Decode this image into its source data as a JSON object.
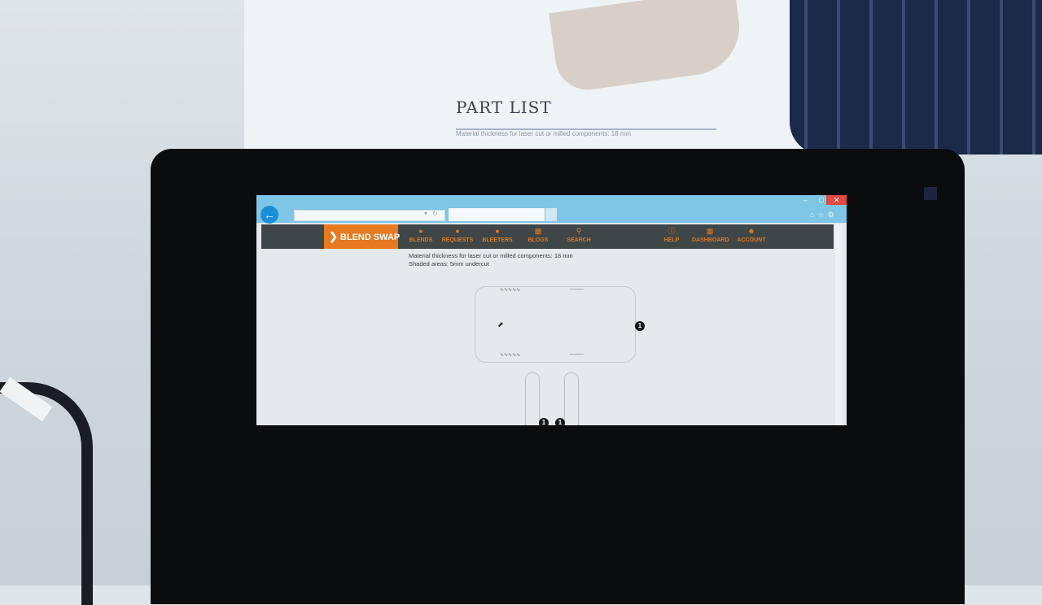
{
  "background": {
    "paper_title": "PART LIST",
    "paper_text": "Material thickness for laser cut or milled components: 18 mm"
  },
  "browser": {
    "back_icon": "back-arrow-icon",
    "address_value": "",
    "window_controls": {
      "minimize": "–",
      "maximize": "□",
      "close": "✕"
    },
    "toolbar_icons": [
      "home-icon",
      "star-icon",
      "gear-icon"
    ]
  },
  "site": {
    "logo": "BLEND SWAP",
    "accent_color": "#e67a20",
    "nav_color": "#3f4647",
    "nav_left": [
      {
        "label": "BLENDS",
        "icon": "blends-icon"
      },
      {
        "label": "REQUESTS",
        "icon": "requests-icon"
      },
      {
        "label": "BLEETERS",
        "icon": "bleeters-icon"
      },
      {
        "label": "BLOGS",
        "icon": "blogs-icon"
      },
      {
        "label": "SEARCH",
        "icon": "search-icon"
      }
    ],
    "nav_right": [
      {
        "label": "HELP",
        "icon": "help-icon"
      },
      {
        "label": "DASHBOARD",
        "icon": "dashboard-icon"
      },
      {
        "label": "ACCOUNT",
        "icon": "account-icon"
      }
    ]
  },
  "content": {
    "line1": "Material thickness for laser cut or milled components: 18 mm",
    "line2": "Shaded areas: 5mm undercut",
    "bullet_marker": "1",
    "bottom_bullets": [
      "1",
      "1"
    ]
  }
}
